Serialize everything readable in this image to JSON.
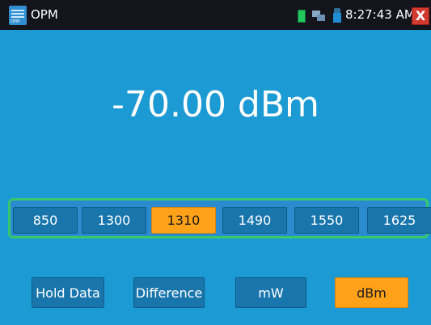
{
  "statusbar": {
    "app_title": "OPM",
    "app_icon_caption": "OPM",
    "time": "8:27:43 AM",
    "close_glyph": "X",
    "icons": [
      "app-icon",
      "battery-icon",
      "network-icon",
      "lock-icon",
      "close-icon"
    ]
  },
  "main": {
    "readout": "-70.00 dBm"
  },
  "wavelengths": {
    "items": [
      "850",
      "1300",
      "1310",
      "1490",
      "1550",
      "1625"
    ],
    "selected": "1310"
  },
  "actions": {
    "hold": "Hold Data",
    "difference": "Difference",
    "mw": "mW",
    "dbm": "dBm",
    "selected_unit": "dBm"
  },
  "colors": {
    "background": "#1c9ad3",
    "statusbar": "#14141c",
    "button": "#1976ad",
    "active": "#ffa21a",
    "wavebar_border": "#38c76a"
  }
}
